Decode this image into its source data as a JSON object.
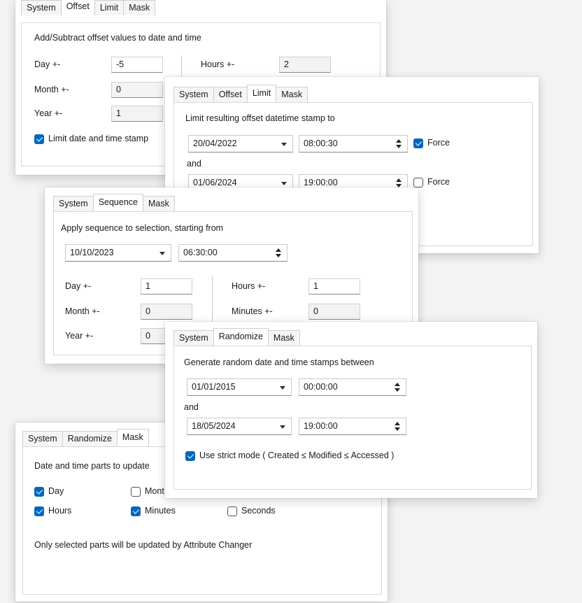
{
  "offset": {
    "tabs": [
      "System",
      "Offset",
      "Limit",
      "Mask"
    ],
    "heading": "Add/Subtract offset values to date and time",
    "day_label": "Day +-",
    "day_value": "-5",
    "month_label": "Month +-",
    "month_value": "0",
    "year_label": "Year +-",
    "year_value": "1",
    "hours_label": "Hours +-",
    "hours_value": "2",
    "limit_checkbox": "Limit date and time stamp",
    "limit_checked": true
  },
  "limit": {
    "tabs": [
      "System",
      "Offset",
      "Limit",
      "Mask"
    ],
    "heading": "Limit resulting offset datetime stamp to",
    "from_date": "20/04/2022",
    "from_time": "08:00:30",
    "force1_label": "Force",
    "force1_checked": true,
    "and_label": "and",
    "to_date": "01/06/2024",
    "to_time": "19:00:00",
    "force2_label": "Force",
    "force2_checked": false
  },
  "sequence": {
    "tabs": [
      "System",
      "Sequence",
      "Mask"
    ],
    "heading": "Apply sequence to selection, starting from",
    "start_date": "10/10/2023",
    "start_time": "06:30:00",
    "day_label": "Day +-",
    "day_value": "1",
    "month_label": "Month +-",
    "month_value": "0",
    "year_label": "Year +-",
    "year_value": "0",
    "hours_label": "Hours +-",
    "hours_value": "1",
    "minutes_label": "Minutes +-",
    "minutes_value": "0"
  },
  "randomize": {
    "tabs": [
      "System",
      "Randomize",
      "Mask"
    ],
    "heading": "Generate random date and time stamps between",
    "from_date": "01/01/2015",
    "from_time": "00:00:00",
    "and_label": "and",
    "to_date": "18/05/2024",
    "to_time": "19:00:00",
    "strict_label": "Use strict mode ( Created ≤ Modified ≤ Accessed )",
    "strict_checked": true
  },
  "mask": {
    "tabs": [
      "System",
      "Randomize",
      "Mask"
    ],
    "heading": "Date and time parts to update",
    "day_label": "Day",
    "day_checked": true,
    "month_label": "Mont",
    "month_checked": false,
    "hours_label": "Hours",
    "hours_checked": true,
    "minutes_label": "Minutes",
    "minutes_checked": true,
    "seconds_label": "Seconds",
    "seconds_checked": false,
    "note": "Only selected parts will be updated by Attribute Changer"
  },
  "colors": {
    "accent": "#0067c0",
    "panel": "#ffffff",
    "background": "#f3f3f3"
  }
}
